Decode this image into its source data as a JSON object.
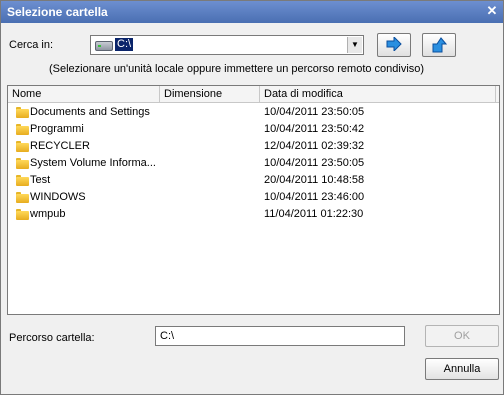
{
  "window": {
    "title": "Selezione cartella",
    "close_glyph": "✕"
  },
  "lookin": {
    "label": "Cerca in:",
    "value": "C:\\",
    "drive_icon": "hard-drive-icon"
  },
  "hint": "(Selezionare un'unità locale oppure immettere un percorso remoto condiviso)",
  "list": {
    "columns": [
      "Nome",
      "Dimensione",
      "Data di modifica"
    ],
    "rows": [
      {
        "name": "Documents and Settings",
        "size": "",
        "date": "10/04/2011 23:50:05"
      },
      {
        "name": "Programmi",
        "size": "",
        "date": "10/04/2011 23:50:42"
      },
      {
        "name": "RECYCLER",
        "size": "",
        "date": "12/04/2011 02:39:32"
      },
      {
        "name": "System Volume Informa...",
        "size": "",
        "date": "10/04/2011 23:50:05"
      },
      {
        "name": "Test",
        "size": "",
        "date": "20/04/2011 10:48:58"
      },
      {
        "name": "WINDOWS",
        "size": "",
        "date": "10/04/2011 23:46:00"
      },
      {
        "name": "wmpub",
        "size": "",
        "date": "11/04/2011 01:22:30"
      }
    ]
  },
  "path": {
    "label": "Percorso cartella:",
    "value": "C:\\"
  },
  "buttons": {
    "ok": "OK",
    "cancel": "Annulla"
  },
  "colors": {
    "titlebar": "#4a6fb2",
    "selection": "#0a246a",
    "arrow_blue": "#1e90ff"
  }
}
